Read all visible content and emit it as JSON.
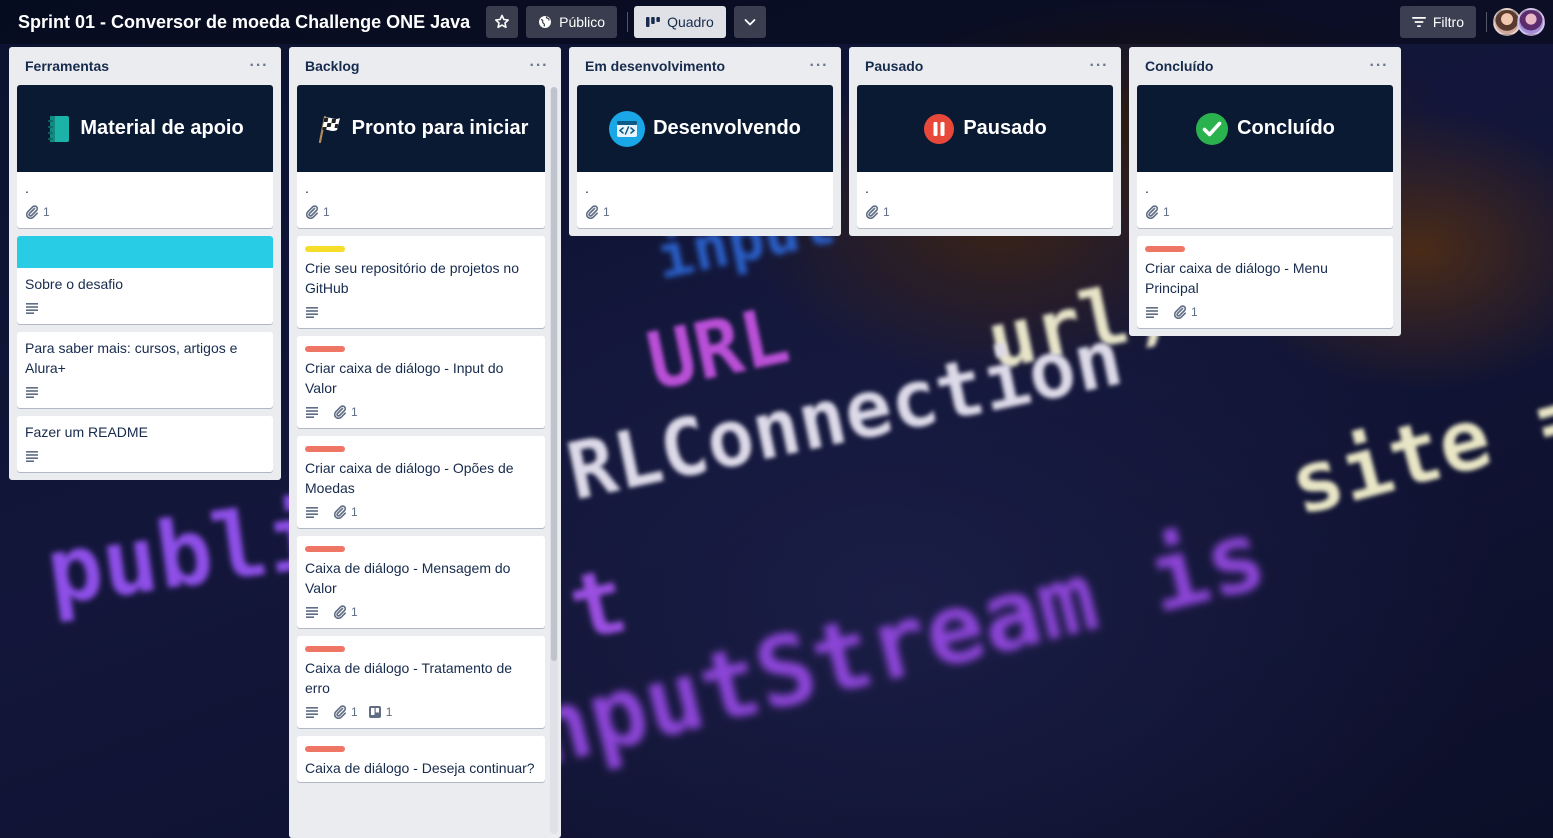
{
  "header": {
    "title": "Sprint 01 - Conversor de moeda Challenge ONE Java",
    "visibility_label": "Público",
    "view_label": "Quadro",
    "filter_label": "Filtro"
  },
  "background_text": [
    "URL",
    "url) {",
    "site =",
    "public",
    "t",
    "RLConnection",
    "nputStream is",
    "input"
  ],
  "lists": [
    {
      "title": "Ferramentas",
      "cards": [
        {
          "cover": "Material de apoio",
          "cover_icon": "notebook-icon",
          "title": ".",
          "attachments": "1"
        },
        {
          "color_cover": "#29cce5",
          "title": "Sobre o desafio",
          "description": true
        },
        {
          "title": "Para saber mais: cursos, artigos e Alura+",
          "description": true
        },
        {
          "title": "Fazer um README",
          "description": true
        }
      ]
    },
    {
      "title": "Backlog",
      "cards": [
        {
          "cover": "Pronto para iniciar",
          "cover_icon": "checkered-flag-icon",
          "title": ".",
          "attachments": "1"
        },
        {
          "label_color": "#f5dd29",
          "title": "Crie seu repositório de projetos no GitHub",
          "description": true
        },
        {
          "label_color": "#ef7564",
          "title": "Criar caixa de diálogo - Input do Valor",
          "description": true,
          "attachments": "1"
        },
        {
          "label_color": "#ef7564",
          "title": "Criar caixa de diálogo - Opões de Moedas",
          "description": true,
          "attachments": "1"
        },
        {
          "label_color": "#ef7564",
          "title": "Caixa de diálogo - Mensagem do Valor",
          "description": true,
          "attachments": "1"
        },
        {
          "label_color": "#ef7564",
          "title": "Caixa de diálogo - Tratamento de erro",
          "description": true,
          "attachments": "1",
          "trello_cards": "1"
        },
        {
          "label_color": "#ef7564",
          "title": "Caixa de diálogo - Deseja continuar?"
        }
      ]
    },
    {
      "title": "Em desenvolvimento",
      "cards": [
        {
          "cover": "Desenvolvendo",
          "cover_icon": "code-window-icon",
          "title": ".",
          "attachments": "1"
        }
      ]
    },
    {
      "title": "Pausado",
      "cards": [
        {
          "cover": "Pausado",
          "cover_icon": "pause-icon",
          "title": ".",
          "attachments": "1"
        }
      ]
    },
    {
      "title": "Concluído",
      "cards": [
        {
          "cover": "Concluído",
          "cover_icon": "check-circle-icon",
          "title": ".",
          "attachments": "1"
        },
        {
          "label_color": "#ef7564",
          "title": "Criar caixa de diálogo - Menu Principal",
          "description": true,
          "attachments": "1"
        }
      ]
    }
  ],
  "colors": {
    "cover_background": "#0b1a33",
    "list_background": "#ebecf0",
    "label_red": "#ef7564",
    "label_yellow": "#f5dd29",
    "cyan_cover": "#29cce5"
  }
}
